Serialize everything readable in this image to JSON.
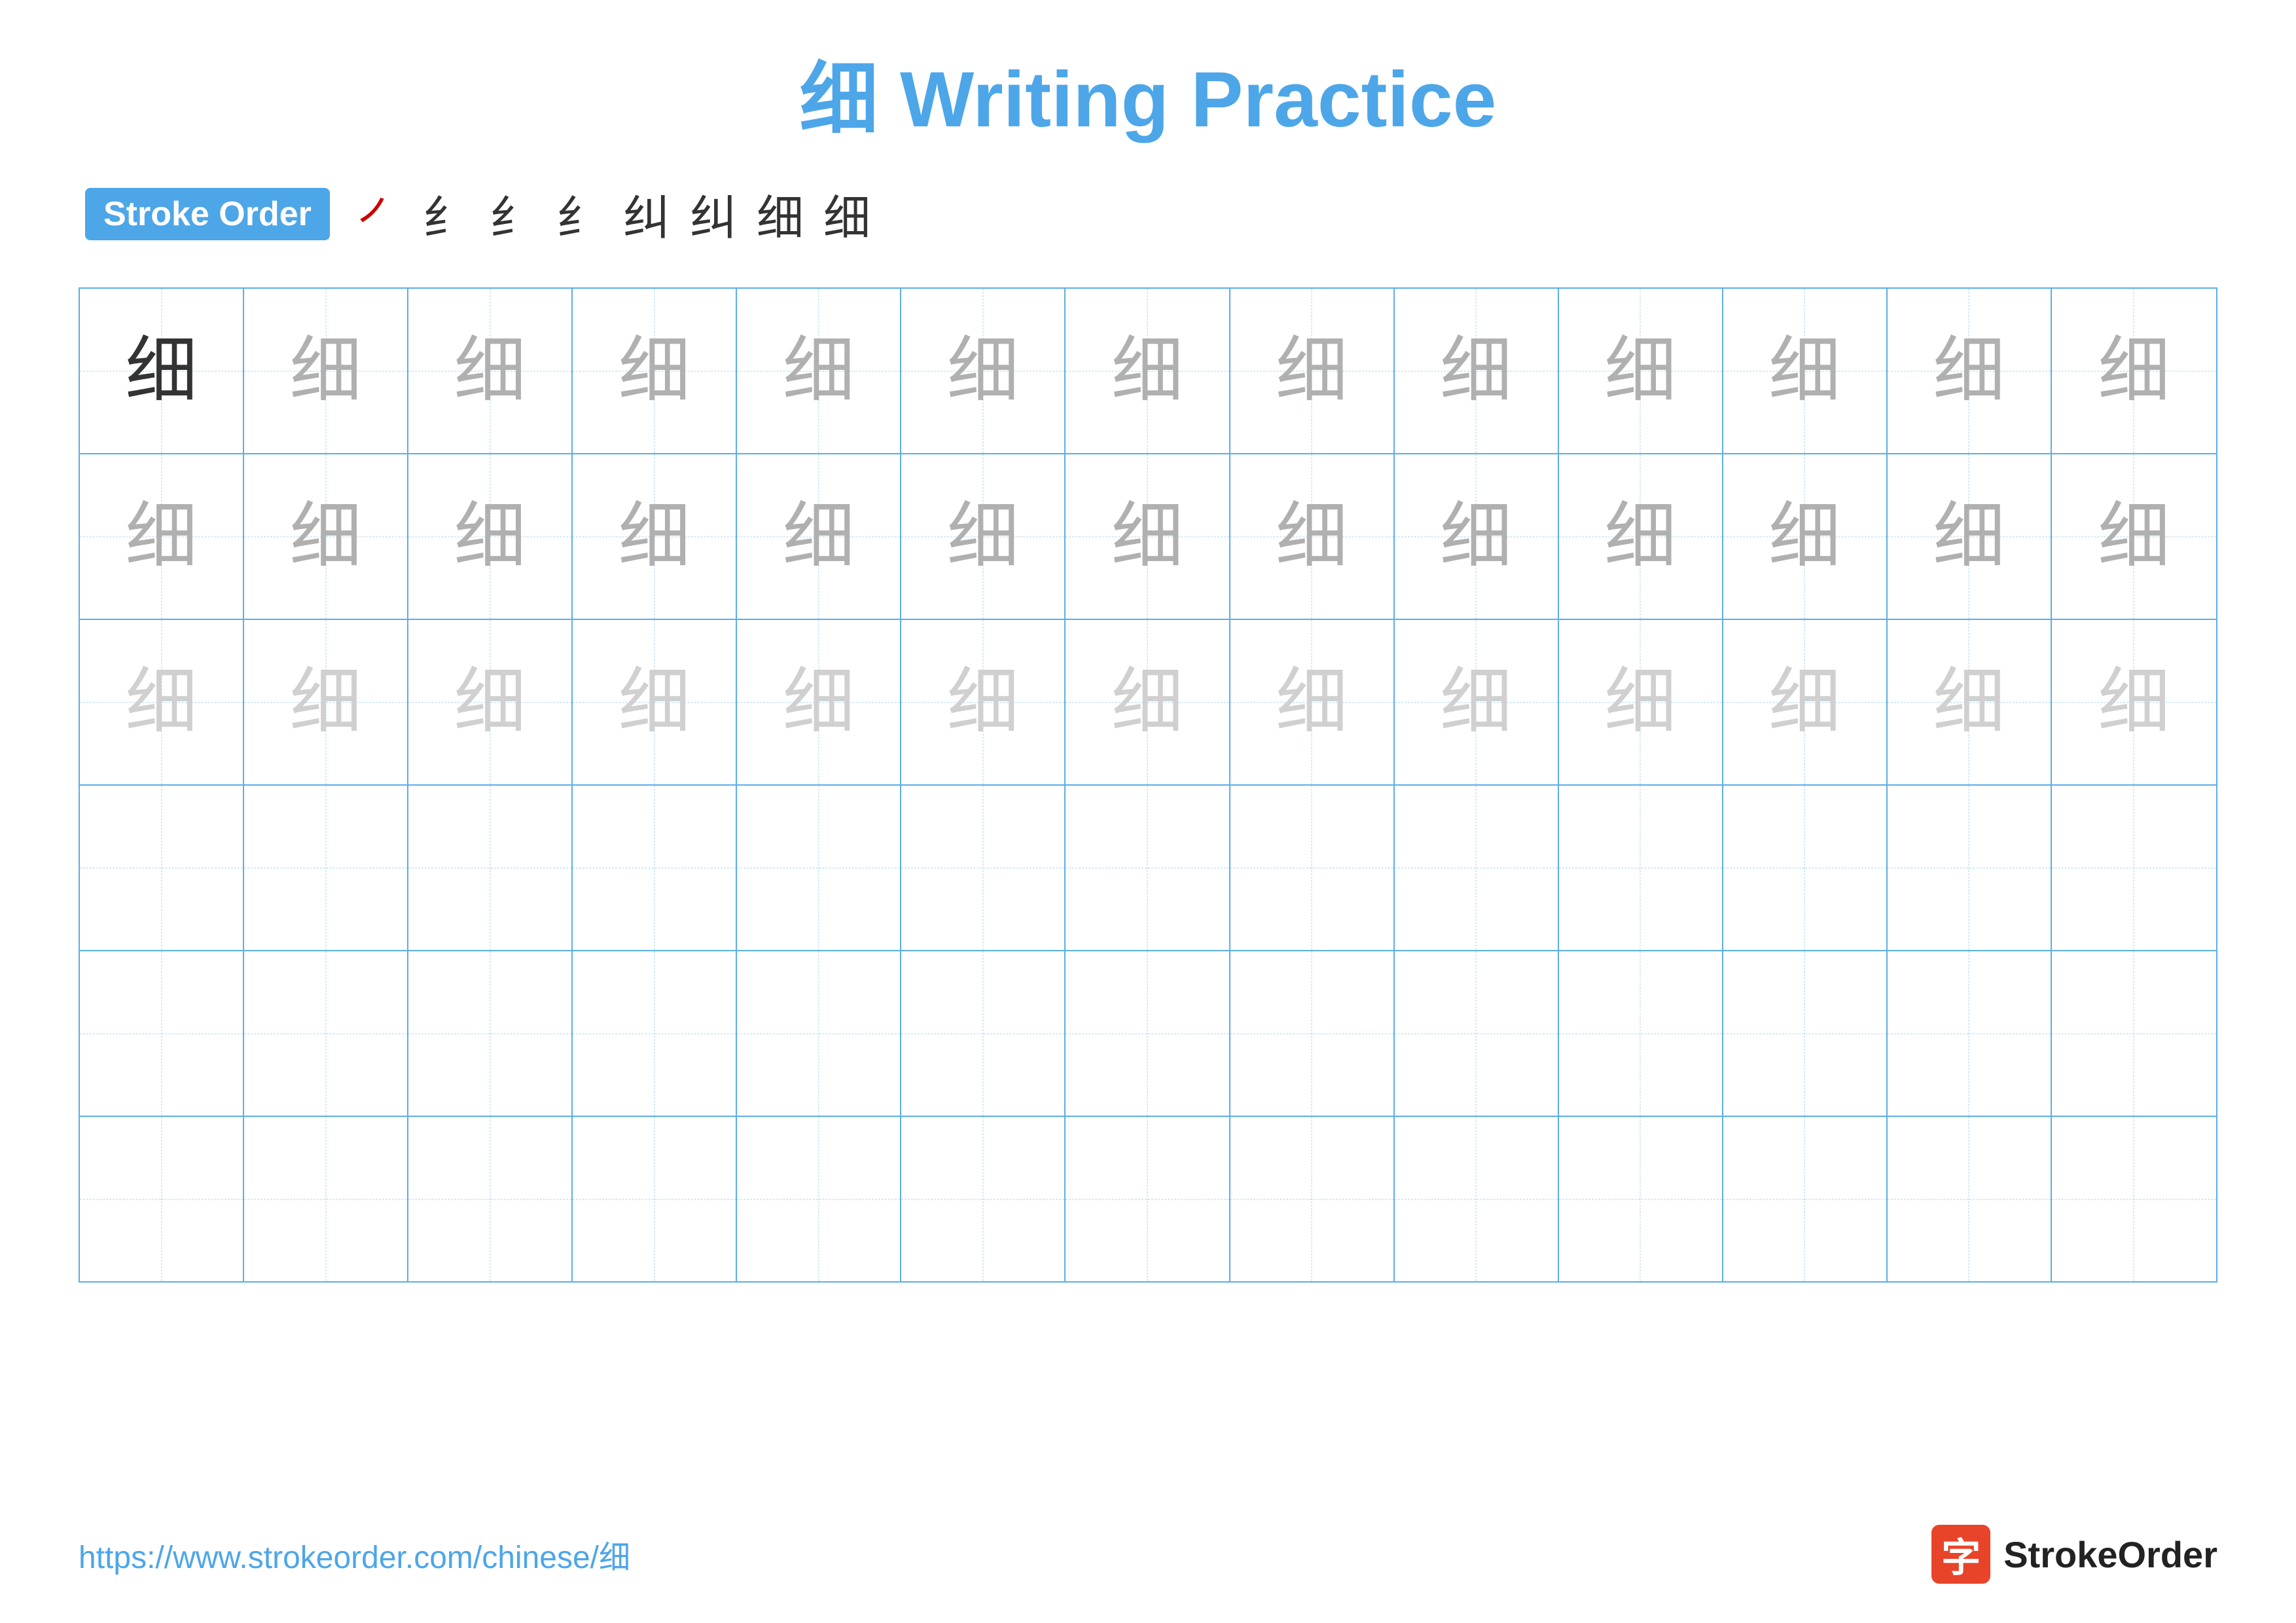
{
  "title": "细 Writing Practice",
  "strokeOrder": {
    "badge": "Stroke Order",
    "steps": [
      "㇒",
      "纟",
      "纟",
      "纟",
      "纠",
      "纠",
      "细",
      "细"
    ]
  },
  "grid": {
    "rows": 6,
    "cols": 13,
    "char": "细",
    "row1": [
      "dark",
      "medium",
      "medium",
      "medium",
      "medium",
      "medium",
      "medium",
      "medium",
      "medium",
      "medium",
      "medium",
      "medium",
      "medium"
    ],
    "row2": [
      "medium",
      "medium",
      "medium",
      "medium",
      "medium",
      "medium",
      "medium",
      "medium",
      "medium",
      "medium",
      "medium",
      "medium",
      "medium"
    ],
    "row3": [
      "light",
      "light",
      "light",
      "light",
      "light",
      "light",
      "light",
      "light",
      "light",
      "light",
      "light",
      "light",
      "light"
    ],
    "row4": [
      "empty",
      "empty",
      "empty",
      "empty",
      "empty",
      "empty",
      "empty",
      "empty",
      "empty",
      "empty",
      "empty",
      "empty",
      "empty"
    ],
    "row5": [
      "empty",
      "empty",
      "empty",
      "empty",
      "empty",
      "empty",
      "empty",
      "empty",
      "empty",
      "empty",
      "empty",
      "empty",
      "empty"
    ],
    "row6": [
      "empty",
      "empty",
      "empty",
      "empty",
      "empty",
      "empty",
      "empty",
      "empty",
      "empty",
      "empty",
      "empty",
      "empty",
      "empty"
    ]
  },
  "footer": {
    "url": "https://www.strokeorder.com/chinese/细",
    "logoText": "StrokeOrder",
    "logoChar": "字"
  }
}
